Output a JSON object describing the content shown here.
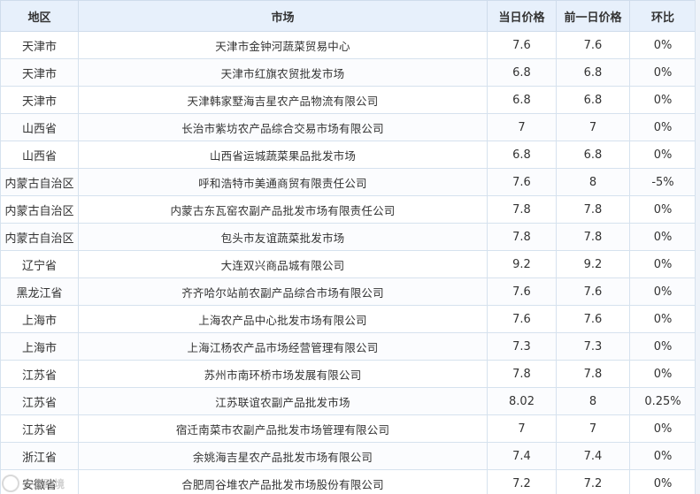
{
  "table": {
    "headers": {
      "region": "地区",
      "market": "市场",
      "today_price": "当日价格",
      "prev_price": "前一日价格",
      "change": "环比"
    },
    "rows": [
      {
        "region": "天津市",
        "market": "天津市金钟河蔬菜贸易中心",
        "today": "7.6",
        "prev": "7.6",
        "change": "0%"
      },
      {
        "region": "天津市",
        "market": "天津市红旗农贸批发市场",
        "today": "6.8",
        "prev": "6.8",
        "change": "0%"
      },
      {
        "region": "天津市",
        "market": "天津韩家墅海吉星农产品物流有限公司",
        "today": "6.8",
        "prev": "6.8",
        "change": "0%"
      },
      {
        "region": "山西省",
        "market": "长治市紫坊农产品综合交易市场有限公司",
        "today": "7",
        "prev": "7",
        "change": "0%"
      },
      {
        "region": "山西省",
        "market": "山西省运城蔬菜果品批发市场",
        "today": "6.8",
        "prev": "6.8",
        "change": "0%"
      },
      {
        "region": "内蒙古自治区",
        "market": "呼和浩特市美通商贸有限责任公司",
        "today": "7.6",
        "prev": "8",
        "change": "-5%"
      },
      {
        "region": "内蒙古自治区",
        "market": "内蒙古东瓦窑农副产品批发市场有限责任公司",
        "today": "7.8",
        "prev": "7.8",
        "change": "0%"
      },
      {
        "region": "内蒙古自治区",
        "market": "包头市友谊蔬菜批发市场",
        "today": "7.8",
        "prev": "7.8",
        "change": "0%"
      },
      {
        "region": "辽宁省",
        "market": "大连双兴商品城有限公司",
        "today": "9.2",
        "prev": "9.2",
        "change": "0%"
      },
      {
        "region": "黑龙江省",
        "market": "齐齐哈尔站前农副产品综合市场有限公司",
        "today": "7.6",
        "prev": "7.6",
        "change": "0%"
      },
      {
        "region": "上海市",
        "market": "上海农产品中心批发市场有限公司",
        "today": "7.6",
        "prev": "7.6",
        "change": "0%"
      },
      {
        "region": "上海市",
        "market": "上海江杨农产品市场经营管理有限公司",
        "today": "7.3",
        "prev": "7.3",
        "change": "0%"
      },
      {
        "region": "江苏省",
        "market": "苏州市南环桥市场发展有限公司",
        "today": "7.8",
        "prev": "7.8",
        "change": "0%"
      },
      {
        "region": "江苏省",
        "market": "江苏联谊农副产品批发市场",
        "today": "8.02",
        "prev": "8",
        "change": "0.25%"
      },
      {
        "region": "江苏省",
        "market": "宿迁南菜市农副产品批发市场管理有限公司",
        "today": "7",
        "prev": "7",
        "change": "0%"
      },
      {
        "region": "浙江省",
        "market": "余姚海吉星农产品批发市场有限公司",
        "today": "7.4",
        "prev": "7.4",
        "change": "0%"
      },
      {
        "region": "安徽省",
        "market": "合肥周谷堆农产品批发市场股份有限公司",
        "today": "7.2",
        "prev": "7.2",
        "change": "0%"
      }
    ]
  },
  "watermark": {
    "text": "头条跨境",
    "icon": "watermark-logo-icon"
  }
}
